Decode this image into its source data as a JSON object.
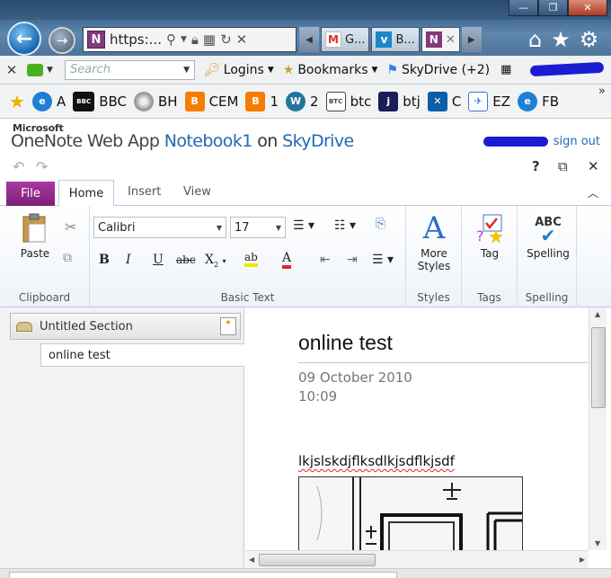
{
  "browser": {
    "window_controls": {
      "minimize": "—",
      "maximize": "❐",
      "close": "✕"
    },
    "address": {
      "text": "https:...",
      "favicon": "N"
    },
    "tabs": [
      {
        "label": "G...",
        "favicon": "M"
      },
      {
        "label": "B...",
        "favicon": "v"
      },
      {
        "label": "",
        "favicon": "N",
        "close": "✕"
      }
    ],
    "command_bar": {
      "search_placeholder": "Search",
      "items": [
        {
          "label": "Logins",
          "icon": "key-icon"
        },
        {
          "label": "Bookmarks",
          "icon": "star-icon"
        },
        {
          "label": "SkyDrive (+2)",
          "icon": "windows-icon"
        }
      ]
    },
    "favorites": [
      {
        "label": "A",
        "icon": "ie-icon",
        "color": "#1e7fd6"
      },
      {
        "label": "BBC",
        "icon": "bbc-icon",
        "color": "#111111"
      },
      {
        "label": "BH",
        "icon": "disc-icon",
        "color": "#7c7c7c"
      },
      {
        "label": "CEM",
        "icon": "blogger-icon",
        "color": "#f57d00"
      },
      {
        "label": "1",
        "icon": "blogger-icon",
        "color": "#f57d00"
      },
      {
        "label": "2",
        "icon": "wordpress-icon",
        "color": "#21759b"
      },
      {
        "label": "btc",
        "icon": "btc-icon",
        "color": "#444444"
      },
      {
        "label": "btj",
        "icon": "j-icon",
        "color": "#1c1c5a"
      },
      {
        "label": "C",
        "icon": "x-icon",
        "color": "#0b5ea8"
      },
      {
        "label": "EZ",
        "icon": "ez-icon",
        "color": "#3a7bd5"
      },
      {
        "label": "FB",
        "icon": "ie-icon",
        "color": "#1e7fd6"
      }
    ]
  },
  "app": {
    "brand_small": "Microsoft",
    "app_name": "OneNote Web App",
    "notebook": "Notebook1",
    "on_word": "on",
    "location": "SkyDrive",
    "sign_out": "sign out",
    "help": "?",
    "ribbon_tabs": {
      "file": "File",
      "home": "Home",
      "insert": "Insert",
      "view": "View"
    },
    "ribbon": {
      "clipboard": {
        "label": "Clipboard",
        "paste": "Paste"
      },
      "basic_text": {
        "label": "Basic Text",
        "font": "Calibri",
        "size": "17"
      },
      "styles": {
        "label": "Styles",
        "more_styles_1": "More",
        "more_styles_2": "Styles"
      },
      "tags": {
        "label": "Tags",
        "tag": "Tag"
      },
      "spelling": {
        "label": "Spelling",
        "spelling": "Spelling",
        "abc": "ABC"
      }
    },
    "navigation": {
      "section": "Untitled Section",
      "page": "online test"
    },
    "page": {
      "title": "online test",
      "date": "09 October 2010",
      "time": "10:09",
      "body_text": "lkjslskdjflksdlkjsdflkjsdf"
    }
  }
}
